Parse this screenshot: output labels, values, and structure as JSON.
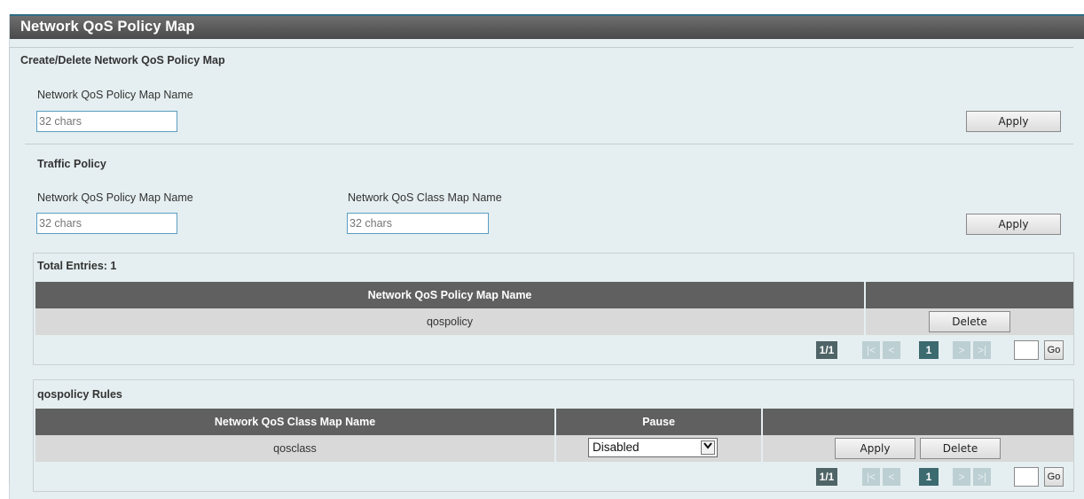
{
  "page_title": "Network QoS Policy Map",
  "create_section": {
    "legend": "Create/Delete Network QoS Policy Map",
    "name_label": "Network QoS Policy Map Name",
    "name_placeholder": "32 chars",
    "apply_label": "Apply"
  },
  "traffic_policy": {
    "title": "Traffic Policy",
    "policy_label": "Network QoS Policy Map Name",
    "policy_placeholder": "32 chars",
    "class_label": "Network QoS Class Map Name",
    "class_placeholder": "32 chars",
    "apply_label": "Apply"
  },
  "policy_table": {
    "total_label": "Total Entries: 1",
    "columns": [
      "Network QoS Policy Map Name",
      ""
    ],
    "rows": [
      {
        "name": "qospolicy",
        "delete_label": "Delete"
      }
    ],
    "pager": {
      "page_info": "1/1",
      "first": "|<",
      "prev": "<",
      "current": "1",
      "next": ">",
      "last": ">|",
      "go_label": "Go"
    }
  },
  "rules_table": {
    "title": "qospolicy Rules",
    "columns": [
      "Network QoS Class Map Name",
      "Pause",
      ""
    ],
    "rows": [
      {
        "class_name": "qosclass",
        "pause_value": "Disabled",
        "apply_label": "Apply",
        "delete_label": "Delete"
      }
    ],
    "pager": {
      "page_info": "1/1",
      "first": "|<",
      "prev": "<",
      "current": "1",
      "next": ">",
      "last": ">|",
      "go_label": "Go"
    }
  },
  "colors": {
    "header_bg": "#606060",
    "panel_bg": "#e5eef0",
    "input_border": "#5a9ec2"
  },
  "icons": {
    "dropdown": "chevron-down-icon"
  }
}
